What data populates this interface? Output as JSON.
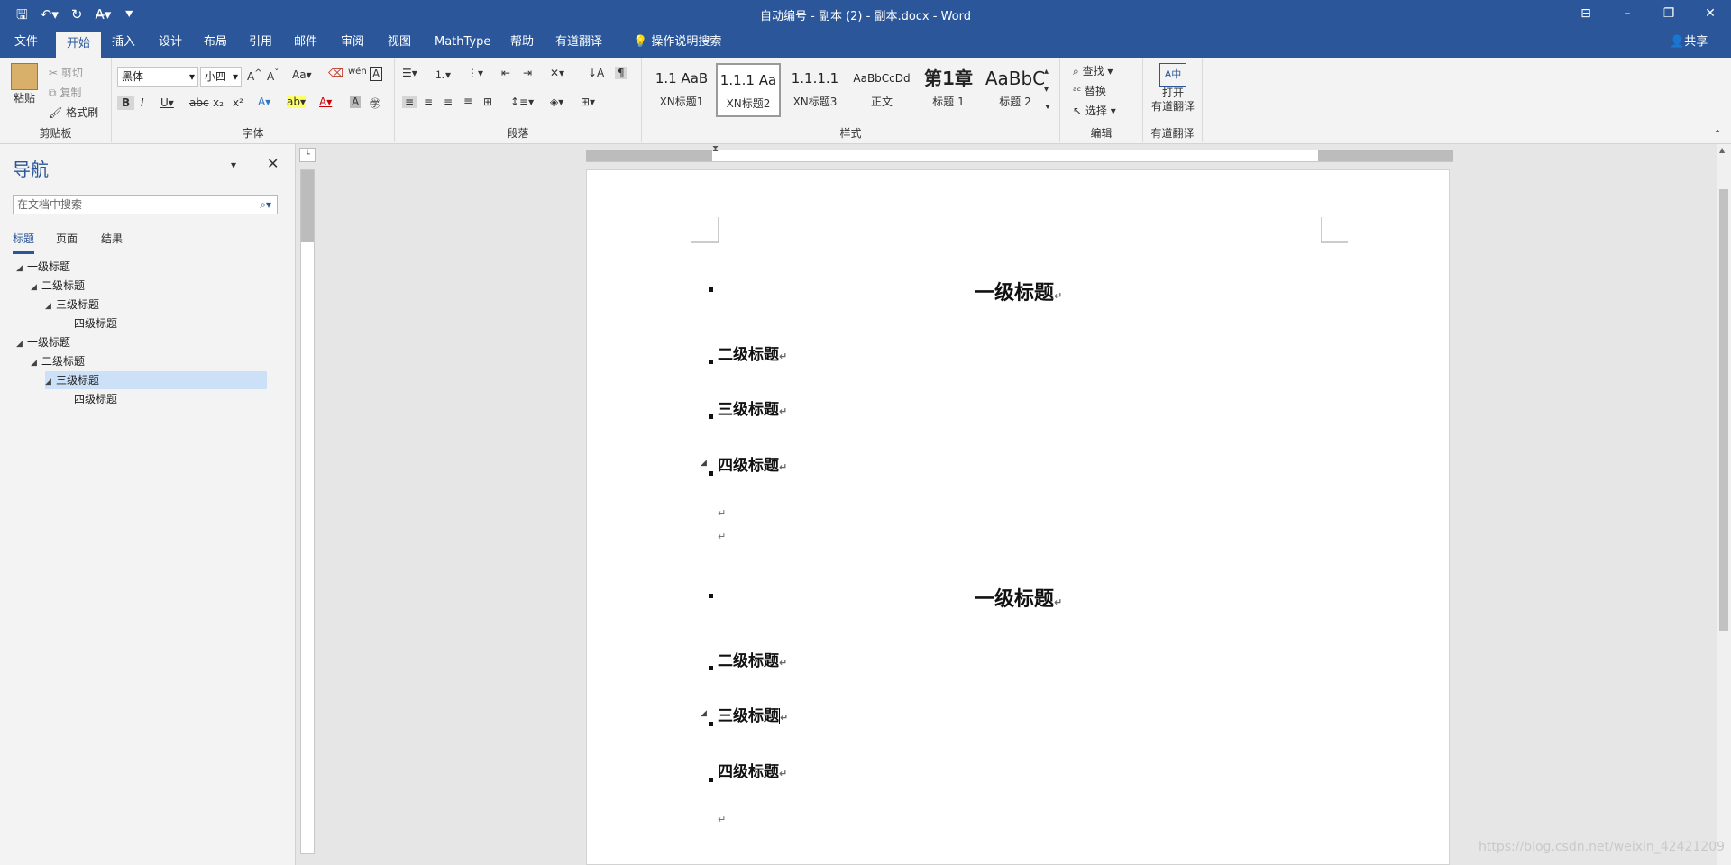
{
  "window": {
    "title": "自动编号 - 副本 (2) - 副本.docx  -  Word",
    "qat": [
      "save-icon",
      "undo-icon",
      "redo-icon",
      "spellcheck-icon",
      "customize-icon"
    ],
    "share_label": "共享"
  },
  "tabs": [
    "文件",
    "开始",
    "插入",
    "设计",
    "布局",
    "引用",
    "邮件",
    "审阅",
    "视图",
    "MathType",
    "帮助",
    "有道翻译"
  ],
  "tellme": "操作说明搜索",
  "ribbon": {
    "clipboard": {
      "paste": "粘贴",
      "cut": "剪切",
      "copy": "复制",
      "format_painter": "格式刷",
      "label": "剪贴板"
    },
    "font": {
      "name": "黑体",
      "size": "小四",
      "label": "字体"
    },
    "paragraph": {
      "label": "段落"
    },
    "styles": {
      "items": [
        {
          "preview": "1.1 AaB",
          "name": "XN标题1"
        },
        {
          "preview": "1.1.1 Aa",
          "name": "XN标题2"
        },
        {
          "preview": "1.1.1.1",
          "name": "XN标题3"
        },
        {
          "preview": "AaBbCcDd",
          "name": "正文"
        },
        {
          "preview": "第1章",
          "name": "标题 1"
        },
        {
          "preview": "AaBbC",
          "name": "标题 2"
        }
      ],
      "label": "样式"
    },
    "editing": {
      "find": "查找",
      "replace": "替换",
      "select": "选择",
      "label": "编辑"
    },
    "translate": {
      "open": "打开\n有道翻译",
      "label": "有道翻译"
    }
  },
  "nav": {
    "title": "导航",
    "search_placeholder": "在文档中搜索",
    "tabs": [
      "标题",
      "页面",
      "结果"
    ],
    "tree": [
      {
        "label": "一级标题",
        "level": 0
      },
      {
        "label": "二级标题",
        "level": 1
      },
      {
        "label": "三级标题",
        "level": 2
      },
      {
        "label": "四级标题",
        "level": 3
      },
      {
        "label": "一级标题",
        "level": 0
      },
      {
        "label": "二级标题",
        "level": 1
      },
      {
        "label": "三级标题",
        "level": 2
      },
      {
        "label": "四级标题",
        "level": 3
      }
    ]
  },
  "doc": {
    "h1a": "一级标题",
    "h2a": "二级标题",
    "h3a": "三级标题",
    "h4a": "四级标题",
    "h1b": "一级标题",
    "h2b": "二级标题",
    "h3b": "三级标题",
    "h4b": "四级标题",
    "para_mark": "↵"
  },
  "watermark": "https://blog.csdn.net/weixin_42421209"
}
